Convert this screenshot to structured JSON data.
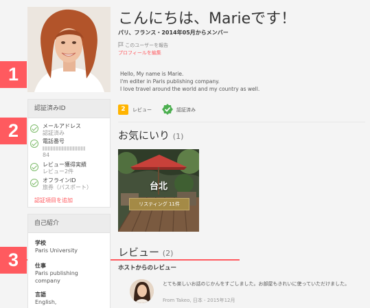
{
  "profile": {
    "greeting": "こんにちは、Marieです！",
    "subtitle": "パリ、フランス・2014年05月からメンバー",
    "report_link": "このユーザーを報告",
    "edit_link": "プロフィールを編集",
    "bio": [
      "Hello, My name is Marie.",
      "I'm editer in Paris publishing company.",
      "I love travel around the world and my country  as well."
    ],
    "review_count_badge": "2",
    "reviews_label": "レビュー",
    "verified_label": "認証済み"
  },
  "markers": [
    "1",
    "2",
    "3"
  ],
  "verified_panel": {
    "title": "認証済みID",
    "items": [
      {
        "title": "メールアドレス",
        "sub": "認証済み"
      },
      {
        "title": "電話番号",
        "sub": "84"
      },
      {
        "title": "レビュー獲得実績",
        "sub": "レビュー2件"
      },
      {
        "title": "オフラインID",
        "sub": "旅券（パスポート）"
      }
    ],
    "add_link": "認証項目を追加"
  },
  "about_panel": {
    "title": "自己紹介",
    "school_label": "学校",
    "school_value": "Paris University",
    "work_label": "仕事",
    "work_value_1": "Paris publishing",
    "work_value_2": "company",
    "language_label": "言語",
    "language_value": "English,"
  },
  "favorites": {
    "heading": "お気にいり",
    "count": "(1)",
    "card_city": "台北",
    "card_button": "リスティング 11件"
  },
  "reviews": {
    "heading": "レビュー",
    "count": "(2)",
    "subheading": "ホストからのレビュー",
    "items": [
      {
        "text": "とても楽しいお話のじかんをすごしました。お部屋もきれいに使っていただけました。",
        "from": "From Takeo, 日本 - 2015年12月"
      }
    ]
  },
  "colors": {
    "accent": "#ff5a5f",
    "verified": "#4caf50",
    "badge": "#ffb400"
  }
}
